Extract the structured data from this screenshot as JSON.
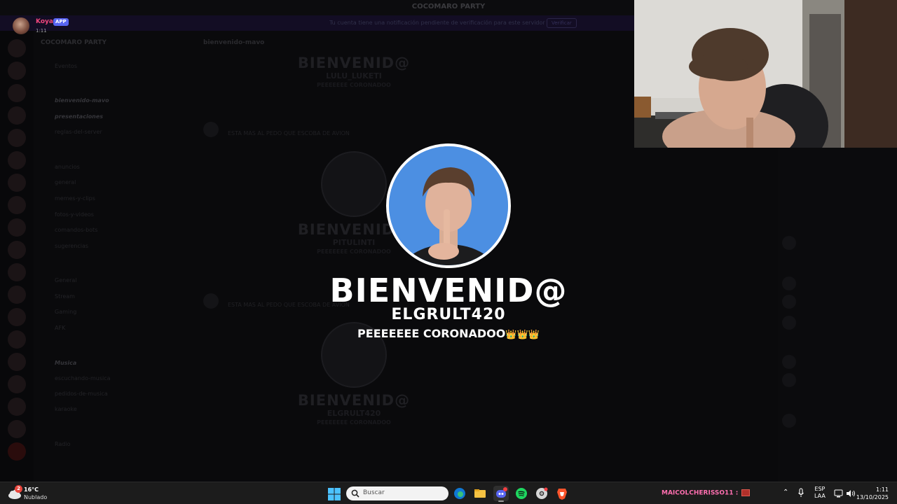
{
  "background": {
    "window_title": "COCOMARO PARTY",
    "notice_text": "Tu cuenta tiene una notificación pendiente de verificación para este servidor",
    "notice_button": "Verificar",
    "server_name": "COCOMARO PARTY",
    "channel_header": "bienvenido-mavo",
    "channels": [
      {
        "label": "Eventos",
        "highlight": false
      },
      {
        "label": "bienvenido-mavo",
        "highlight": true
      },
      {
        "label": "presentaciones",
        "highlight": true
      },
      {
        "label": "reglas-del-server",
        "highlight": false
      },
      {
        "label": "anuncios",
        "highlight": false
      },
      {
        "label": "general",
        "highlight": false
      },
      {
        "label": "memes-y-clips",
        "highlight": false
      },
      {
        "label": "fotos-y-videos",
        "highlight": false
      },
      {
        "label": "comandos-bots",
        "highlight": false
      },
      {
        "label": "sugerencias",
        "highlight": false
      },
      {
        "label": "General",
        "highlight": false
      },
      {
        "label": "Stream",
        "highlight": false
      },
      {
        "label": "Gaming",
        "highlight": false
      },
      {
        "label": "AFK",
        "highlight": false
      },
      {
        "label": "Musica",
        "highlight": true
      },
      {
        "label": "escuchando-musica",
        "highlight": false
      },
      {
        "label": "pedidos-de-musica",
        "highlight": false
      },
      {
        "label": "karaoke",
        "highlight": false
      },
      {
        "label": "Radio",
        "highlight": false
      }
    ],
    "messages": [
      "ESTA MAS AL PEDO QUE ESCOBA DE AVION",
      "ESTA MAS AL PEDO QUE ESCOBA DE AVION"
    ],
    "mini_cards": [
      {
        "title": "BIENVENID@",
        "name": "LULU_LUKETI",
        "caption": "PEEEEEEE CORONADOO"
      },
      {
        "title": "BIENVENID@",
        "name": "PITULINTI",
        "caption": "PEEEEEEE CORONADOO"
      },
      {
        "title": "BIENVENID@",
        "name": "ELGRULT420",
        "caption": "PEEEEEEE CORONADOO"
      }
    ]
  },
  "user_badge": {
    "name": "Koya",
    "app_tag": "APP",
    "time": "1:11",
    "name_color": "#f2477e"
  },
  "welcome": {
    "title": "BIENVENID@",
    "username": "ELGRULT420",
    "caption": "PEEEEEEE CORONADOO",
    "crowns": "👑👑👑",
    "accent": "#4a8ee0"
  },
  "taskbar": {
    "weather_temp": "16°C",
    "weather_desc": "Nublado",
    "weather_badge": "2",
    "search_placeholder": "Buscar",
    "apps": [
      "edge-icon",
      "file-explorer-icon",
      "discord-icon",
      "spotify-icon",
      "chrome-icon",
      "brave-icon"
    ],
    "chat_ticker_user": "MAICOLCHERISSO11 :",
    "lang_top": "ESP",
    "lang_bottom": "LAA",
    "time": "1:11",
    "date": "13/10/2025"
  }
}
